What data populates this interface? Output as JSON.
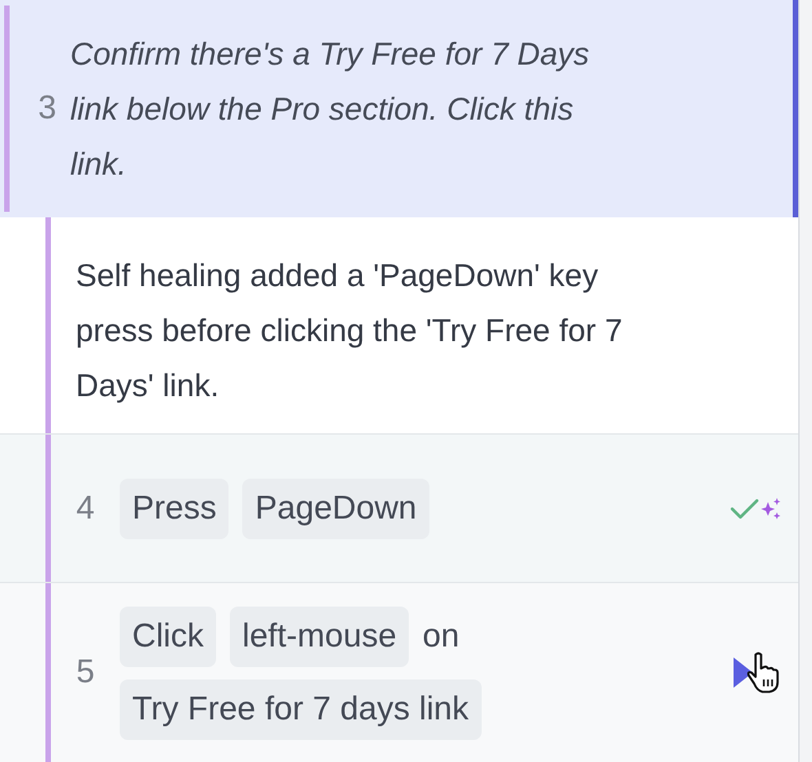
{
  "steps": [
    {
      "kind": "step",
      "number": "3",
      "selected": true,
      "text": "Confirm there's a Try Free for 7 Days link below the Pro section. Click this link."
    },
    {
      "kind": "note",
      "text": "Self healing added a 'PageDown' key press before clicking the 'Try Free for 7 Days' link."
    },
    {
      "kind": "action",
      "number": "4",
      "selected": false,
      "healed": true,
      "playing": false,
      "parts": [
        {
          "kind": "chip",
          "text": "Press"
        },
        {
          "kind": "chip",
          "text": "PageDown"
        }
      ]
    },
    {
      "kind": "action",
      "number": "5",
      "selected": false,
      "healed": false,
      "playing": true,
      "parts": [
        {
          "kind": "chip",
          "text": "Click"
        },
        {
          "kind": "chip",
          "text": "left-mouse"
        },
        {
          "kind": "word",
          "text": "on"
        },
        {
          "kind": "chip",
          "text": "Try Free for 7 days link"
        }
      ]
    }
  ]
}
